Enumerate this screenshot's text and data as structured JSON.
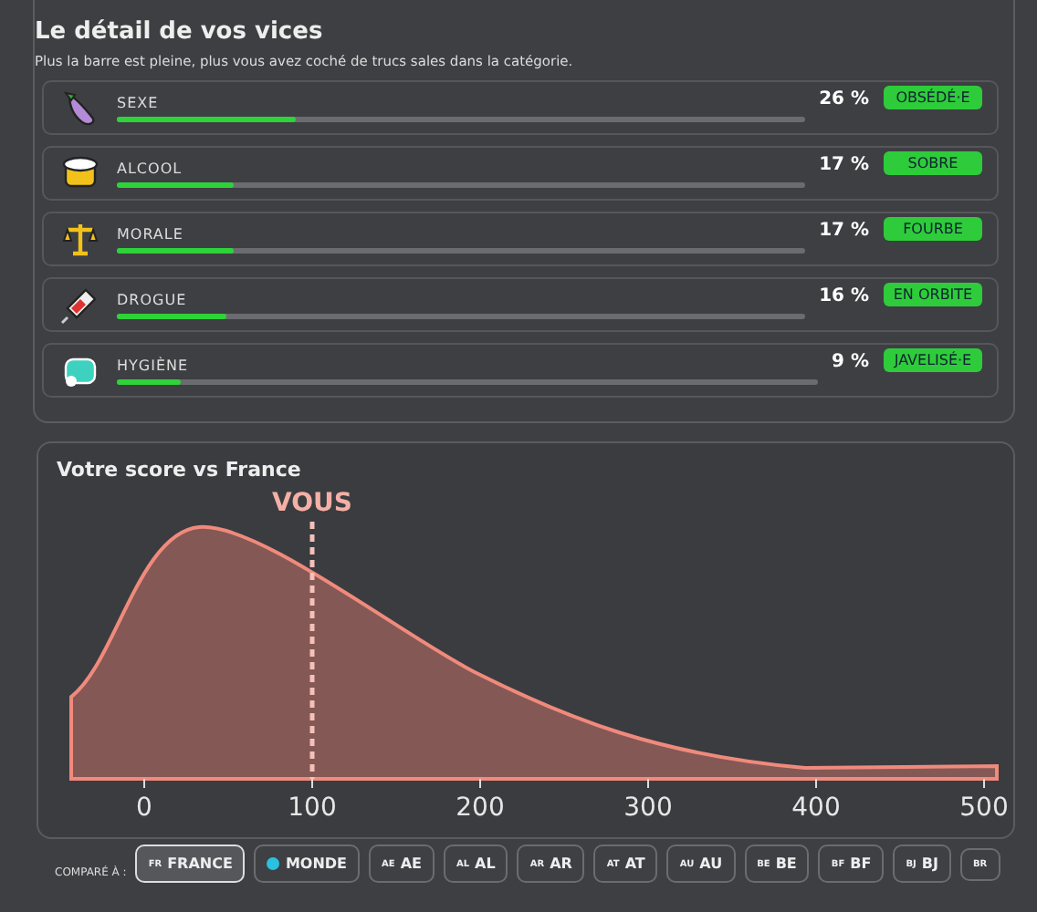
{
  "vices_panel": {
    "title": "Le détail de vos vices",
    "subtitle": "Plus la barre est pleine, plus vous avez coché de trucs sales dans la catégorie.",
    "rows": [
      {
        "label": "SEXE",
        "level": 0.26,
        "percent": "26 %",
        "badge": "OBSÉDÉ·E"
      },
      {
        "label": "ALCOOL",
        "level": 0.17,
        "percent": "17 %",
        "badge": "SOBRE"
      },
      {
        "label": "MORALE",
        "level": 0.17,
        "percent": "17 %",
        "badge": "FOURBE"
      },
      {
        "label": "DROGUE",
        "level": 0.16,
        "percent": "16 %",
        "badge": "EN ORBITE"
      },
      {
        "label": "HYGIÈNE",
        "level": 0.09,
        "percent": "9 %",
        "badge": "JAVELISÉ·E"
      }
    ]
  },
  "score_panel": {
    "title": "Votre score vs France",
    "marker_label": "VOUS",
    "x_axis_labels": [
      "0",
      "100",
      "200",
      "300",
      "400",
      "500"
    ]
  },
  "compare": {
    "label": "COMPARÉ À :",
    "options": [
      {
        "kind": "country",
        "code": "FR",
        "label": "FRANCE",
        "selected": true
      },
      {
        "kind": "world",
        "label": "MONDE",
        "selected": false
      },
      {
        "kind": "country",
        "code": "AE",
        "label": "AE",
        "selected": false
      },
      {
        "kind": "country",
        "code": "AL",
        "label": "AL",
        "selected": false
      },
      {
        "kind": "country",
        "code": "AR",
        "label": "AR",
        "selected": false
      },
      {
        "kind": "country",
        "code": "AT",
        "label": "AT",
        "selected": false
      },
      {
        "kind": "country",
        "code": "AU",
        "label": "AU",
        "selected": false
      },
      {
        "kind": "country",
        "code": "BE",
        "label": "BE",
        "selected": false
      },
      {
        "kind": "country",
        "code": "BF",
        "label": "BF",
        "selected": false
      },
      {
        "kind": "country",
        "code": "BJ",
        "label": "BJ",
        "selected": false
      },
      {
        "kind": "country",
        "code": "BR",
        "selected": false
      }
    ]
  }
}
